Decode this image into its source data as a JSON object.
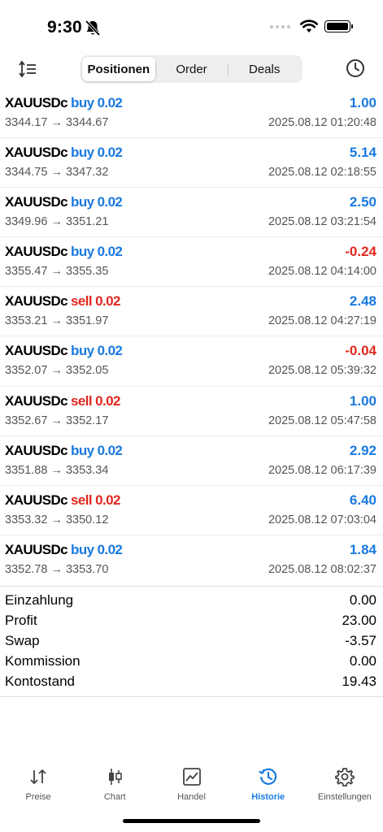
{
  "status_bar": {
    "time": "9:30"
  },
  "toolbar": {
    "tabs": [
      {
        "label": "Positionen",
        "active": true
      },
      {
        "label": "Order",
        "active": false
      },
      {
        "label": "Deals",
        "active": false
      }
    ],
    "left_icon": "sort-icon",
    "right_icon": "history-clock-icon"
  },
  "trades": [
    {
      "symbol": "XAUUSDc",
      "side": "buy",
      "volume": "buy 0.02",
      "profit": "1.00",
      "prices": "3344.17 → 3344.67",
      "time": "2025.08.12 01:20:48"
    },
    {
      "symbol": "XAUUSDc",
      "side": "buy",
      "volume": "buy 0.02",
      "profit": "5.14",
      "prices": "3344.75 → 3347.32",
      "time": "2025.08.12 02:18:55"
    },
    {
      "symbol": "XAUUSDc",
      "side": "buy",
      "volume": "buy 0.02",
      "profit": "2.50",
      "prices": "3349.96 → 3351.21",
      "time": "2025.08.12 03:21:54"
    },
    {
      "symbol": "XAUUSDc",
      "side": "buy",
      "volume": "buy 0.02",
      "profit": "-0.24",
      "prices": "3355.47 → 3355.35",
      "time": "2025.08.12 04:14:00"
    },
    {
      "symbol": "XAUUSDc",
      "side": "sell",
      "volume": "sell 0.02",
      "profit": "2.48",
      "prices": "3353.21 → 3351.97",
      "time": "2025.08.12 04:27:19"
    },
    {
      "symbol": "XAUUSDc",
      "side": "buy",
      "volume": "buy 0.02",
      "profit": "-0.04",
      "prices": "3352.07 → 3352.05",
      "time": "2025.08.12 05:39:32"
    },
    {
      "symbol": "XAUUSDc",
      "side": "sell",
      "volume": "sell 0.02",
      "profit": "1.00",
      "prices": "3352.67 → 3352.17",
      "time": "2025.08.12 05:47:58"
    },
    {
      "symbol": "XAUUSDc",
      "side": "buy",
      "volume": "buy 0.02",
      "profit": "2.92",
      "prices": "3351.88 → 3353.34",
      "time": "2025.08.12 06:17:39"
    },
    {
      "symbol": "XAUUSDc",
      "side": "sell",
      "volume": "sell 0.02",
      "profit": "6.40",
      "prices": "3353.32 → 3350.12",
      "time": "2025.08.12 07:03:04"
    },
    {
      "symbol": "XAUUSDc",
      "side": "buy",
      "volume": "buy 0.02",
      "profit": "1.84",
      "prices": "3352.78 → 3353.70",
      "time": "2025.08.12 08:02:37"
    }
  ],
  "summary": [
    {
      "label": "Einzahlung",
      "value": "0.00"
    },
    {
      "label": "Profit",
      "value": "23.00"
    },
    {
      "label": "Swap",
      "value": "-3.57"
    },
    {
      "label": "Kommission",
      "value": "0.00"
    },
    {
      "label": "Kontostand",
      "value": "19.43"
    }
  ],
  "tabbar": [
    {
      "label": "Preise",
      "icon": "quotes-arrows-icon",
      "active": false
    },
    {
      "label": "Chart",
      "icon": "candlestick-icon",
      "active": false
    },
    {
      "label": "Handel",
      "icon": "trade-chart-icon",
      "active": false
    },
    {
      "label": "Historie",
      "icon": "history-icon",
      "active": true
    },
    {
      "label": "Einstellungen",
      "icon": "gear-icon",
      "active": false
    }
  ],
  "colors": {
    "accent": "#1a7ae0",
    "negative": "#e0281f"
  }
}
